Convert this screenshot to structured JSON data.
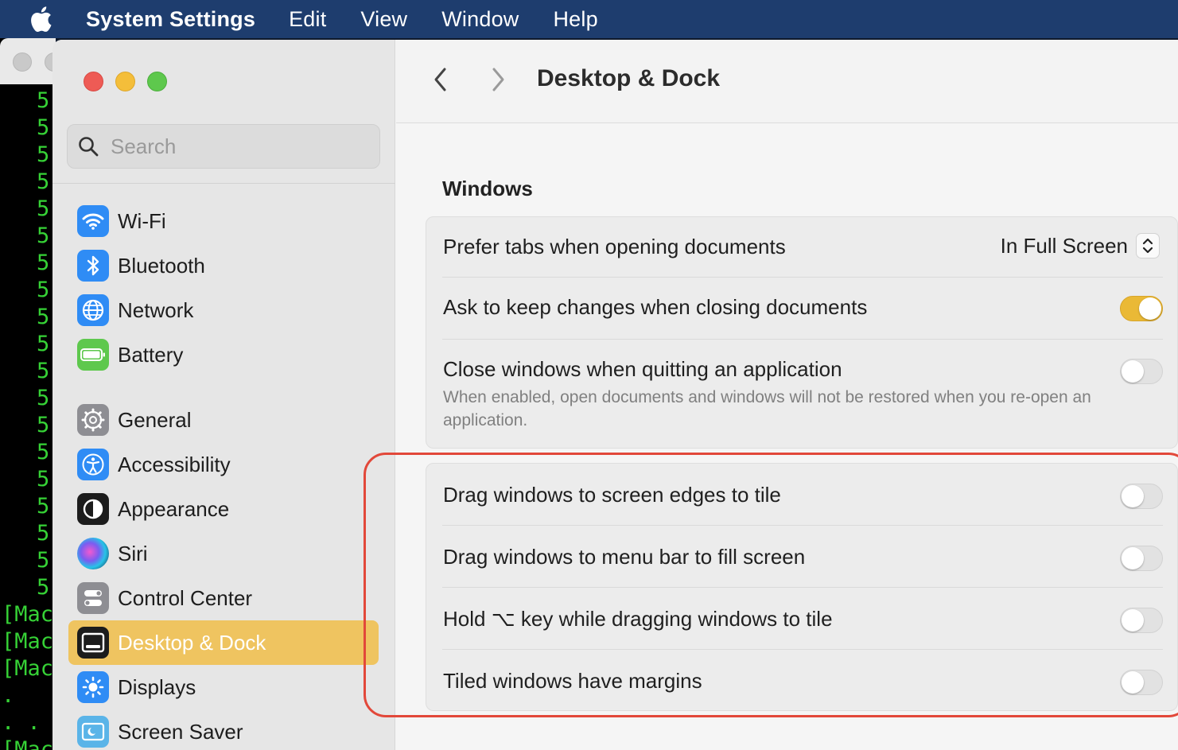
{
  "menubar": {
    "app_name": "System Settings",
    "items": [
      "Edit",
      "View",
      "Window",
      "Help"
    ]
  },
  "terminal": {
    "lines": [
      "5",
      "5",
      "5",
      "5",
      "5",
      "5",
      "5",
      "5",
      "5",
      "5",
      "5",
      "5",
      "5",
      "5",
      "5",
      "5",
      "5",
      "5",
      "5"
    ],
    "mac_lines": [
      "[Mac",
      "[Mac",
      "[Mac"
    ],
    "dot_lines": [
      ".",
      ". ."
    ],
    "last_line": "[Mac"
  },
  "search": {
    "placeholder": "Search"
  },
  "sidebar": {
    "items": [
      {
        "label": "Wi-Fi",
        "icon": "wifi-icon",
        "color": "#2f8cf5"
      },
      {
        "label": "Bluetooth",
        "icon": "bluetooth-icon",
        "color": "#2f8cf5"
      },
      {
        "label": "Network",
        "icon": "globe-icon",
        "color": "#2f8cf5"
      },
      {
        "label": "Battery",
        "icon": "battery-icon",
        "color": "#5ec84d"
      },
      {
        "label": "General",
        "icon": "gear-icon",
        "color": "#8e8e93"
      },
      {
        "label": "Accessibility",
        "icon": "accessibility-icon",
        "color": "#2f8cf5"
      },
      {
        "label": "Appearance",
        "icon": "appearance-icon",
        "color": "#1c1c1c"
      },
      {
        "label": "Siri",
        "icon": "siri-icon",
        "color": "#3a3a6a"
      },
      {
        "label": "Control Center",
        "icon": "control-center-icon",
        "color": "#8e8e93"
      },
      {
        "label": "Desktop & Dock",
        "icon": "dock-icon",
        "color": "#1c1c1c"
      },
      {
        "label": "Displays",
        "icon": "sun-icon",
        "color": "#2f8cf5"
      },
      {
        "label": "Screen Saver",
        "icon": "screen-saver-icon",
        "color": "#5ab4e8"
      }
    ],
    "active_index": 9,
    "active_color": "#efc460"
  },
  "toolbar": {
    "title": "Desktop & Dock"
  },
  "windows_section": {
    "title": "Windows",
    "prefer_tabs": {
      "label": "Prefer tabs when opening documents",
      "value": "In Full Screen"
    },
    "ask_keep_changes": {
      "label": "Ask to keep changes when closing documents",
      "on": true
    },
    "close_windows": {
      "label": "Close windows when quitting an application",
      "sub": "When enabled, open documents and windows will not be restored when you re-open an application.",
      "on": false
    }
  },
  "tiling_section": {
    "rows": [
      {
        "label": "Drag windows to screen edges to tile",
        "on": false
      },
      {
        "label": "Drag windows to menu bar to fill screen",
        "on": false
      },
      {
        "label": "Hold ⌥ key while dragging windows to tile",
        "on": false
      },
      {
        "label": "Tiled windows have margins",
        "on": false
      }
    ]
  },
  "colors": {
    "accent": "#eab936",
    "highlight": "#e2483a",
    "menubar": "#1e3d6e"
  }
}
